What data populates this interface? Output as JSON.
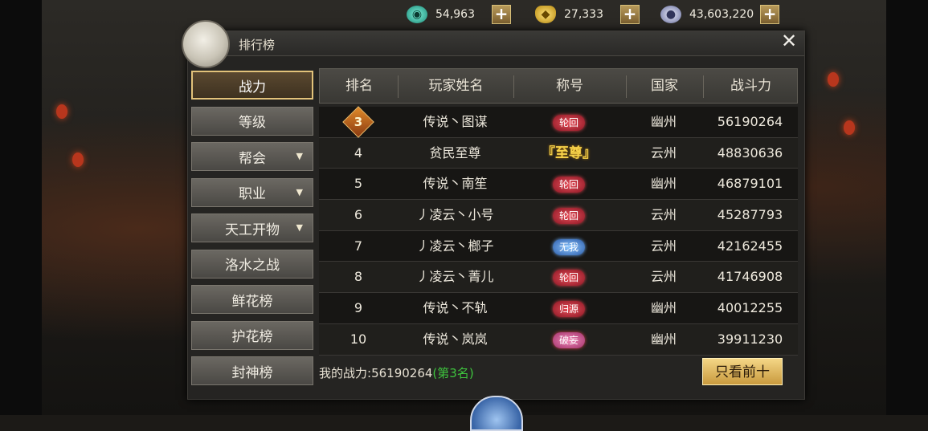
{
  "currencies": [
    {
      "icon": "jade-icon",
      "value": "54,963"
    },
    {
      "icon": "gold-ingot-icon",
      "value": "27,333"
    },
    {
      "icon": "silver-coin-icon",
      "value": "43,603,220"
    }
  ],
  "plus_label": "+",
  "panel": {
    "title": "排行榜",
    "close_label": "✕"
  },
  "sidebar": {
    "items": [
      {
        "label": "战力",
        "active": true,
        "has_dropdown": false
      },
      {
        "label": "等级",
        "active": false,
        "has_dropdown": false
      },
      {
        "label": "帮会",
        "active": false,
        "has_dropdown": true
      },
      {
        "label": "职业",
        "active": false,
        "has_dropdown": true
      },
      {
        "label": "天工开物",
        "active": false,
        "has_dropdown": true
      },
      {
        "label": "洛水之战",
        "active": false,
        "has_dropdown": false
      },
      {
        "label": "鲜花榜",
        "active": false,
        "has_dropdown": false
      },
      {
        "label": "护花榜",
        "active": false,
        "has_dropdown": false
      },
      {
        "label": "封神榜",
        "active": false,
        "has_dropdown": false
      }
    ],
    "dropdown_glyph": "▼"
  },
  "table": {
    "headers": [
      "排名",
      "玩家姓名",
      "称号",
      "国家",
      "战斗力"
    ],
    "rows": [
      {
        "rank": "3",
        "name": "传说丶图谋",
        "title": "轮回",
        "title_style": "red",
        "nation": "幽州",
        "power": "56190264"
      },
      {
        "rank": "4",
        "name": "贫民至尊",
        "title": "『至尊』",
        "title_style": "gold",
        "nation": "云州",
        "power": "48830636"
      },
      {
        "rank": "5",
        "name": "传说丶南笙",
        "title": "轮回",
        "title_style": "red",
        "nation": "幽州",
        "power": "46879101"
      },
      {
        "rank": "6",
        "name": "丿凌云丶小号",
        "title": "轮回",
        "title_style": "red",
        "nation": "云州",
        "power": "45287793"
      },
      {
        "rank": "7",
        "name": "丿凌云丶榔子",
        "title": "无我",
        "title_style": "blue",
        "nation": "云州",
        "power": "42162455"
      },
      {
        "rank": "8",
        "name": "丿凌云丶菁儿",
        "title": "轮回",
        "title_style": "red",
        "nation": "云州",
        "power": "41746908"
      },
      {
        "rank": "9",
        "name": "传说丶不轨",
        "title": "归源",
        "title_style": "red",
        "nation": "幽州",
        "power": "40012255"
      },
      {
        "rank": "10",
        "name": "传说丶岚岚",
        "title": "破妄",
        "title_style": "pink",
        "nation": "幽州",
        "power": "39911230"
      }
    ]
  },
  "footer": {
    "my_power_label": "我的战力:",
    "my_power_value": "56190264",
    "my_rank": "(第3名)",
    "top_ten_button": "只看前十"
  },
  "colors": {
    "accent_gold": "#e2c27a",
    "rank_green": "#3ec43e",
    "panel_bg": "#252422"
  }
}
